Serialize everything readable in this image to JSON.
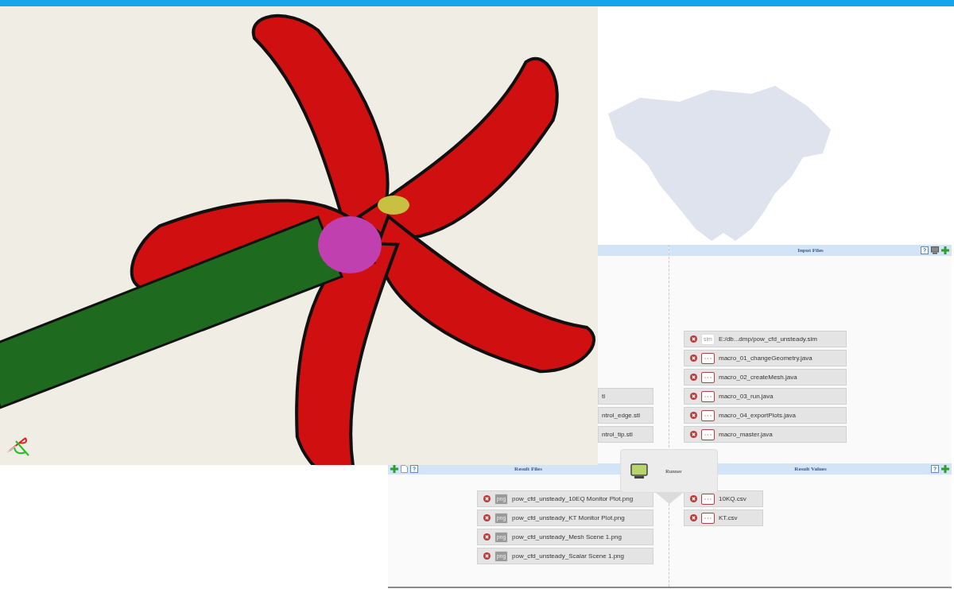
{
  "geometry_panel": {
    "items": [
      {
        "name": "tl"
      },
      {
        "name": "ntrol_edge.stl"
      },
      {
        "name": "ntrol_tip.stl"
      }
    ]
  },
  "input_files": {
    "title": "Input Files",
    "tools": [
      {
        "kind": "help"
      },
      {
        "kind": "monitor"
      },
      {
        "kind": "add"
      }
    ],
    "items": [
      {
        "name": "E:/db...dmp/pow_cfd_unsteady.sim",
        "kind": "sim",
        "type_label": "sim"
      },
      {
        "name": "macro_01_changeGeometry.java",
        "kind": "file"
      },
      {
        "name": "macro_02_createMesh.java",
        "kind": "file"
      },
      {
        "name": "macro_03_run.java",
        "kind": "file"
      },
      {
        "name": "macro_04_exportPlots.java",
        "kind": "file"
      },
      {
        "name": "macro_master.java",
        "kind": "file"
      }
    ]
  },
  "runner": {
    "label": "Runner"
  },
  "result_files": {
    "title": "Result Files",
    "tools": [
      {
        "kind": "add"
      },
      {
        "kind": "document"
      },
      {
        "kind": "help"
      }
    ],
    "items": [
      {
        "name": "pow_cfd_unsteady_10EQ Monitor Plot.png",
        "kind": "png",
        "type_label": "png"
      },
      {
        "name": "pow_cfd_unsteady_KT Monitor Plot.png",
        "kind": "png",
        "type_label": "png"
      },
      {
        "name": "pow_cfd_unsteady_Mesh Scene 1.png",
        "kind": "png",
        "type_label": "png"
      },
      {
        "name": "pow_cfd_unsteady_Scalar Scene 1.png",
        "kind": "png",
        "type_label": "png"
      }
    ]
  },
  "result_values": {
    "title": "Result Values",
    "tools": [
      {
        "kind": "help"
      },
      {
        "kind": "add"
      }
    ],
    "items": [
      {
        "name": "10KQ.csv",
        "kind": "file"
      },
      {
        "name": "KT.csv",
        "kind": "file"
      }
    ]
  }
}
